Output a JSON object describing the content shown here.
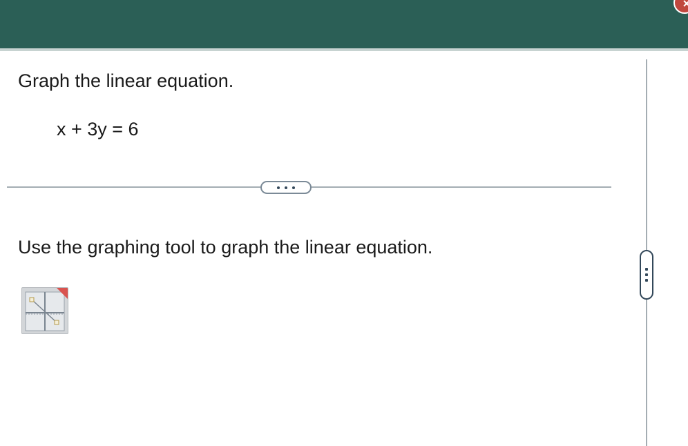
{
  "header": {
    "close_icon": "close-icon",
    "accent_color": "#2b5f56",
    "close_color": "#c0473e"
  },
  "question": {
    "prompt": "Graph the linear equation.",
    "equation": "x + 3y = 6"
  },
  "divider": {
    "expand_icon": "ellipsis-horizontal-icon"
  },
  "instruction": {
    "text": "Use the graphing tool to graph the linear equation."
  },
  "graph_tool": {
    "icon": "graph-tool-icon"
  },
  "side_panel": {
    "handle_icon": "ellipsis-vertical-icon"
  }
}
